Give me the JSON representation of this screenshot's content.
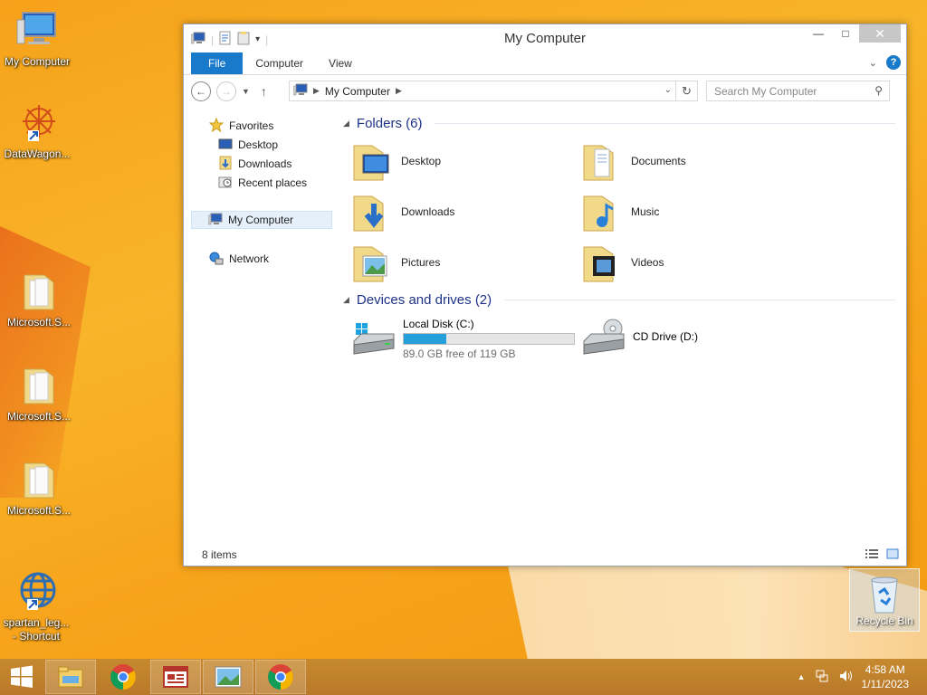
{
  "desktop": {
    "icons": [
      {
        "label": "My Computer"
      },
      {
        "label": "DataWagon..."
      },
      {
        "label": "Microsoft.S..."
      },
      {
        "label": "Microsoft.S..."
      },
      {
        "label": "Microsoft.S..."
      },
      {
        "label": "spartan_leg...\n- Shortcut"
      }
    ],
    "recycle_bin": "Recycle Bin"
  },
  "window": {
    "title": "My Computer",
    "ribbon_tabs": [
      "File",
      "Computer",
      "View"
    ],
    "address": {
      "location": "My Computer"
    },
    "search_placeholder": "Search My Computer",
    "nav": {
      "favorites": "Favorites",
      "favorites_items": [
        "Desktop",
        "Downloads",
        "Recent places"
      ],
      "this_pc": "My Computer",
      "network": "Network"
    },
    "folders_header": "Folders (6)",
    "folders": [
      "Desktop",
      "Documents",
      "Downloads",
      "Music",
      "Pictures",
      "Videos"
    ],
    "devices_header": "Devices and drives (2)",
    "drives": [
      {
        "name": "Local Disk (C:)",
        "free_text": "89.0 GB free of 119 GB",
        "used_fraction": 0.25
      },
      {
        "name": "CD Drive (D:)"
      }
    ],
    "status": "8 items"
  },
  "taskbar": {
    "time": "4:58 AM",
    "date": "1/11/2023"
  },
  "colors": {
    "accent": "#1979ca",
    "desktop": "#f8b52a",
    "progress": "#26a0da"
  }
}
